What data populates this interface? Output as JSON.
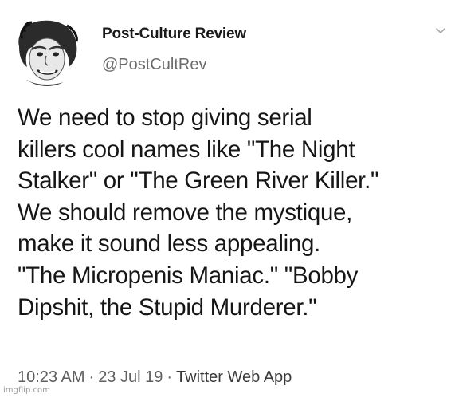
{
  "account": {
    "display_name": "Post-Culture Review",
    "handle": "@PostCultRev"
  },
  "icons": {
    "avatar": "avatar-portrait-icon",
    "menu": "chevron-down-icon"
  },
  "tweet": {
    "lines": [
      "We need to stop giving serial",
      "killers cool names like \"The Night",
      "Stalker\" or \"The Green River Killer.\"",
      "We should remove the mystique,",
      "make it sound less appealing.",
      "\"The Micropenis Maniac.\" \"Bobby",
      "Dipshit, the Stupid Murderer.\""
    ]
  },
  "meta": {
    "time": "10:23 AM",
    "separator": "·",
    "date": "23 Jul 19",
    "source": "Twitter Web App"
  },
  "watermark": "imgflip.com"
}
